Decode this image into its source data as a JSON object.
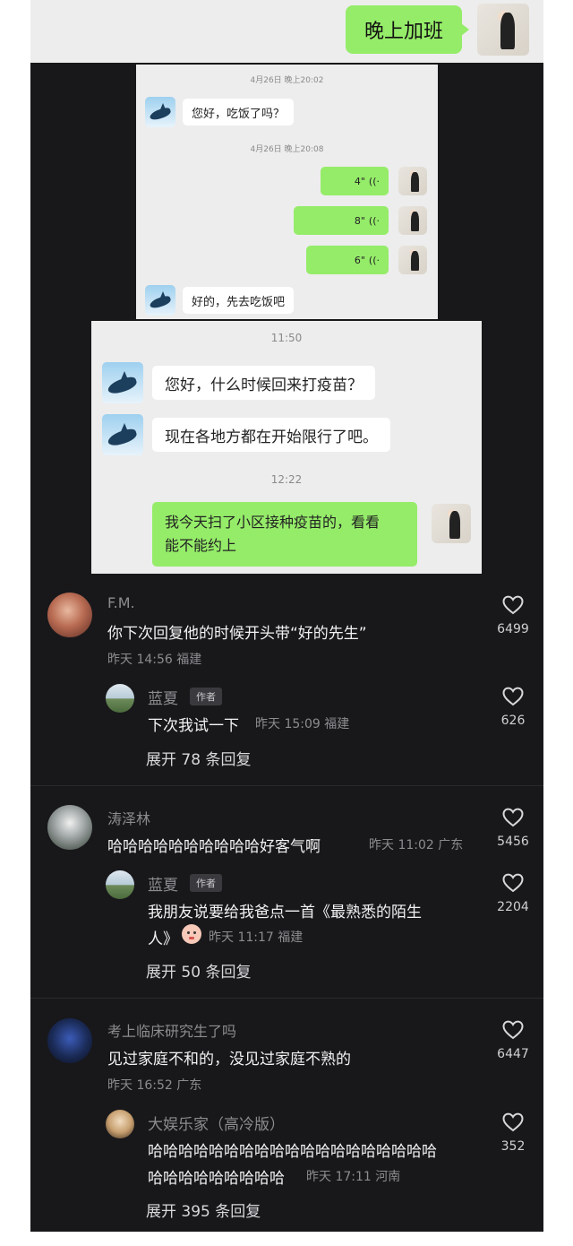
{
  "top": {
    "message": "晚上加班"
  },
  "chat1": {
    "time1": "4月26日 晚上20:02",
    "msg1": "您好，吃饭了吗？",
    "time2": "4月26日 晚上20:08",
    "voice": [
      "4\"",
      "8\"",
      "6\""
    ],
    "msg2": "好的，先去吃饭吧"
  },
  "chat2": {
    "time1": "11:50",
    "msg1": "您好，什么时候回来打疫苗？",
    "msg2": "现在各地方都在开始限行了吧。",
    "time2": "12:22",
    "reply_line1": "我今天扫了小区接种疫苗的，看看",
    "reply_line2": "能不能约上"
  },
  "comments": [
    {
      "user": "F.M.",
      "text": "你下次回复他的时候开头带“好的先生”",
      "meta": "昨天 14:56 福建",
      "likes": "6499",
      "reply": {
        "user": "蓝夏",
        "tag": "作者",
        "text": "下次我试一下",
        "meta": "昨天 15:09 福建",
        "likes": "626"
      },
      "expand": "展开 78 条回复"
    },
    {
      "user": "涛泽林",
      "text": "哈哈哈哈哈哈哈哈哈哈好客气啊",
      "meta": "昨天 11:02 广东",
      "likes": "5456",
      "reply": {
        "user": "蓝夏",
        "tag": "作者",
        "text_line1": "我朋友说要给我爸点一首《最熟悉的陌生",
        "text_line2": "人》",
        "meta": "昨天 11:17 福建",
        "likes": "2204"
      },
      "expand": "展开 50 条回复"
    },
    {
      "user": "考上临床研究生了吗",
      "text": "见过家庭不和的，没见过家庭不熟的",
      "meta": "昨天 16:52 广东",
      "likes": "6447",
      "reply": {
        "user": "大娱乐家（高冷版）",
        "text_line1": "哈哈哈哈哈哈哈哈哈哈哈哈哈哈哈哈哈哈哈",
        "text_line2": "哈哈哈哈哈哈哈哈哈",
        "meta": "昨天 17:11 河南",
        "likes": "352"
      },
      "expand": "展开 395 条回复"
    }
  ],
  "colors": {
    "green_bubble": "#95ec69",
    "feed_bg": "#18181b",
    "chat_bg": "#ededed"
  },
  "icons": [
    "heart-icon",
    "voice-icon",
    "dolphin-avatar",
    "girl-avatar",
    "baby-emoji"
  ]
}
